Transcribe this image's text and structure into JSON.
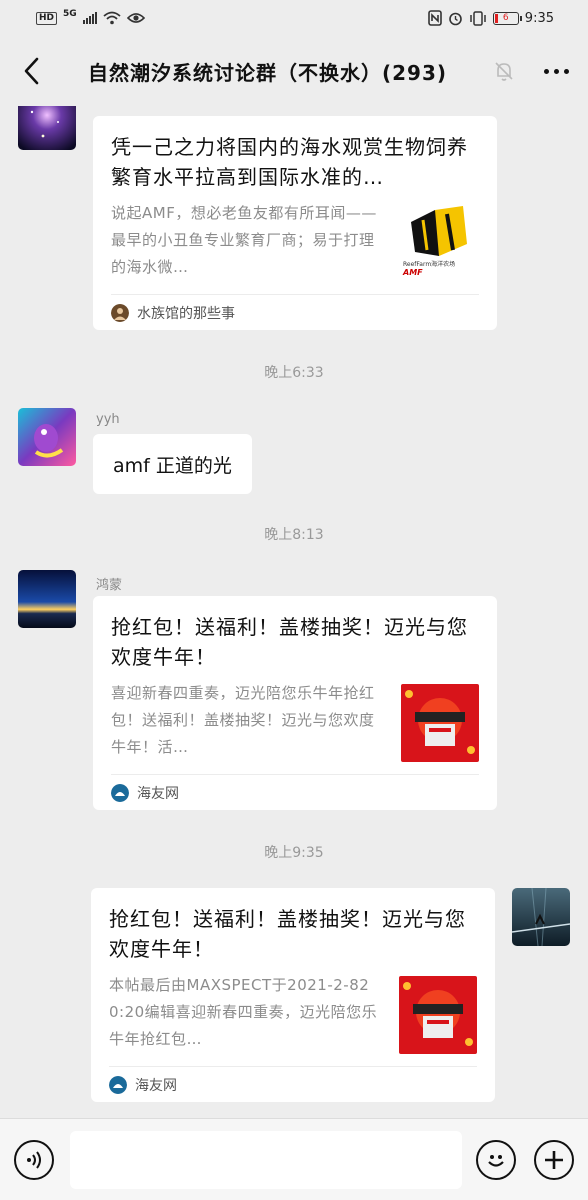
{
  "status_bar": {
    "hd": "HD",
    "network": "5G",
    "battery_level": "6",
    "time": "9:35",
    "icons": [
      "nfc-icon",
      "alarm-icon",
      "vibrate-icon",
      "battery-icon"
    ]
  },
  "nav": {
    "title": "自然潮汐系统讨论群（不换水）(293)",
    "icons": [
      "back-arrow-icon",
      "mute-bell-icon",
      "more-icon"
    ]
  },
  "messages": [
    {
      "type": "card",
      "sender": "",
      "title": "凭一己之力将国内的海水观赏生物饲养繁育水平拉高到国际水准的…",
      "description": "说起AMF，想必老鱼友都有所耳闻——最早的小丑鱼专业繁育厂商；易于打理的海水微…",
      "source": "水族馆的那些事",
      "thumb_caption": "ReefFarm海洋农场",
      "thumb_logo": "AMF"
    },
    {
      "type": "time",
      "text": "晚上6:33"
    },
    {
      "type": "text",
      "sender": "yyh",
      "text": "amf 正道的光"
    },
    {
      "type": "time",
      "text": "晚上8:13"
    },
    {
      "type": "card",
      "sender": "鸿蒙",
      "title": "抢红包！送福利！盖楼抽奖！迈光与您欢度牛年！",
      "description": "喜迎新春四重奏，迈光陪您乐牛年抢红包！送福利！盖楼抽奖！迈光与您欢度牛年！活…",
      "source": "海友网"
    },
    {
      "type": "time",
      "text": "晚上9:35"
    },
    {
      "type": "card",
      "sender": "self",
      "title": "抢红包！送福利！盖楼抽奖！迈光与您欢度牛年！",
      "description": "本帖最后由MAXSPECT于2021-2-820:20编辑喜迎新春四重奏，迈光陪您乐牛年抢红包…",
      "source": "海友网"
    }
  ],
  "input_bar": {
    "placeholder": "",
    "icons": [
      "voice-icon",
      "emoji-icon",
      "plus-icon"
    ]
  },
  "colors": {
    "background": "#ededed",
    "bubble": "#ffffff",
    "muted_text": "#8c8c8c",
    "time_text": "#999999"
  }
}
